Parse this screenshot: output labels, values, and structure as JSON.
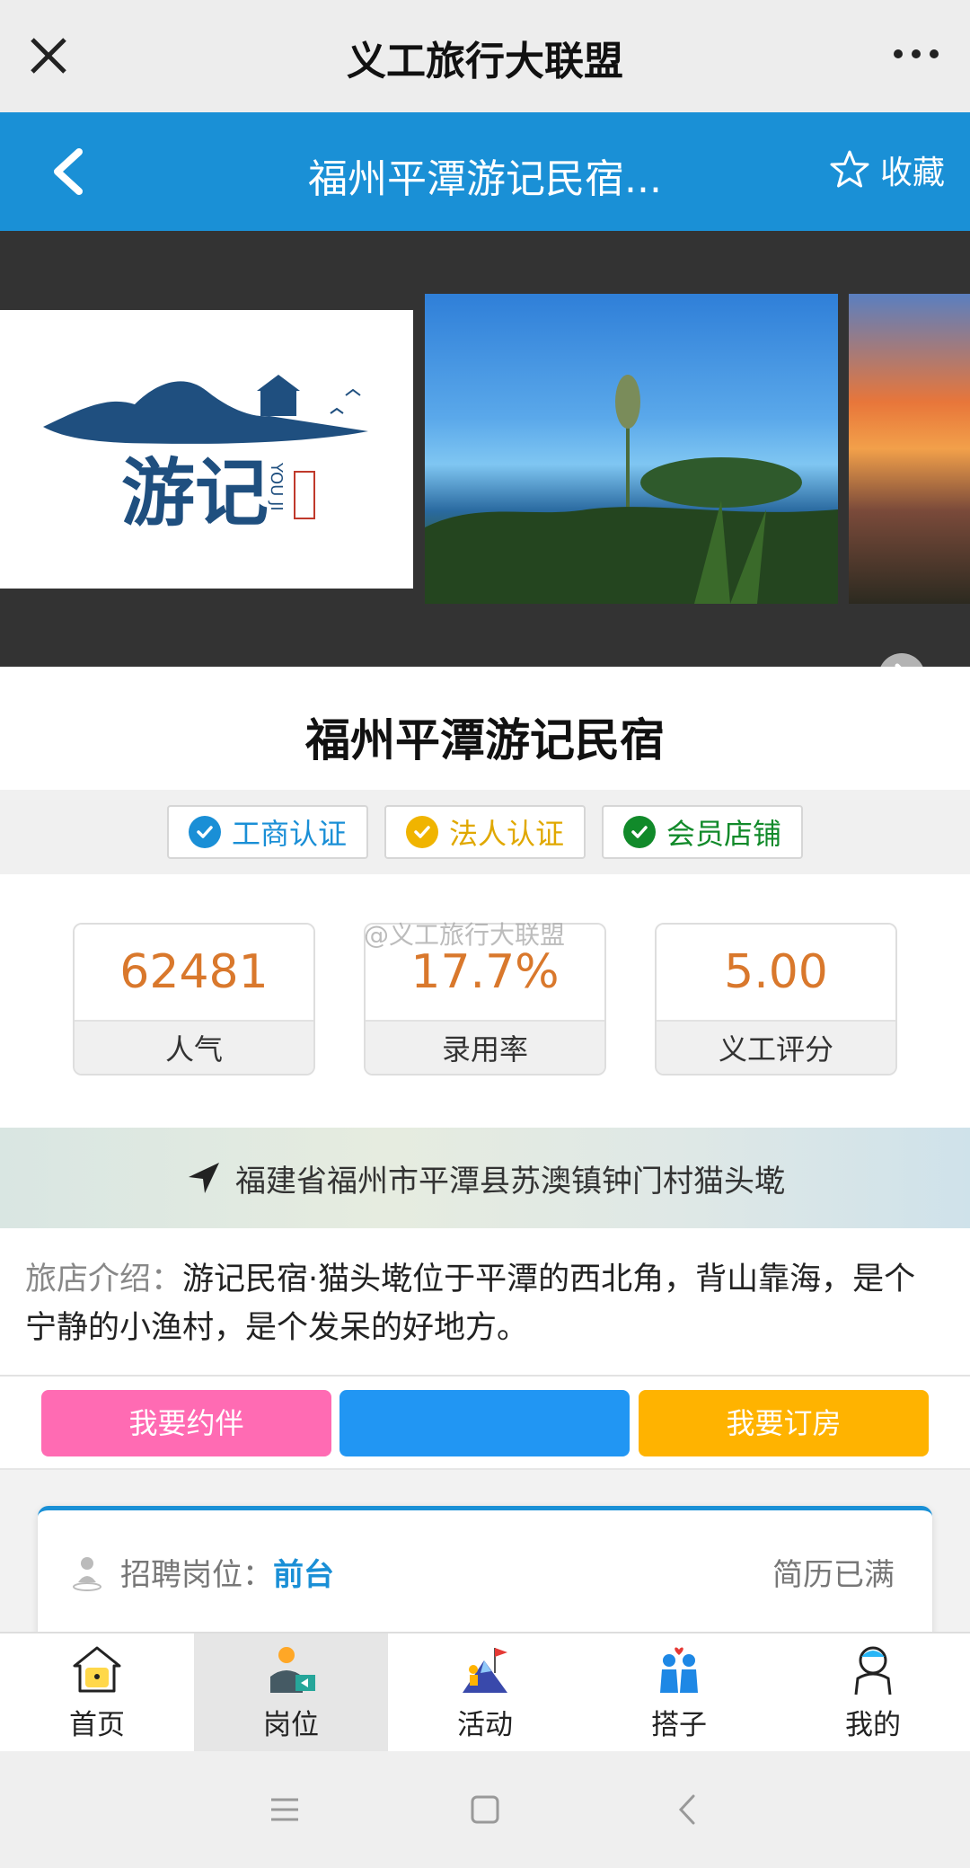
{
  "wechat_bar": {
    "title": "义工旅行大联盟"
  },
  "header": {
    "title": "福州平潭游记民宿...",
    "favorite_label": "收藏"
  },
  "carousel": {
    "slide_count": 3,
    "active_index": 0
  },
  "hostel": {
    "name": "福州平潭游记民宿"
  },
  "badges": [
    {
      "label": "工商认证",
      "color": "#1a8fd6"
    },
    {
      "label": "法人认证",
      "color": "#f0b400"
    },
    {
      "label": "会员店铺",
      "color": "#118a2a"
    }
  ],
  "stats": [
    {
      "value": "62481",
      "label": "人气"
    },
    {
      "value": "17.7%",
      "label": "录用率"
    },
    {
      "value": "5.00",
      "label": "义工评分"
    }
  ],
  "watermark": "@义工旅行大联盟",
  "address": "福建省福州市平潭县苏澳镇钟门村猫头墘",
  "intro": {
    "label": "旅店介绍：",
    "text": "游记民宿·猫头墘位于平潭的西北角，背山靠海，是个宁静的小渔村，是个发呆的好地方。"
  },
  "actions": {
    "partner": "我要约伴",
    "middle": "",
    "book": "我要订房"
  },
  "job": {
    "label": "招聘岗位：",
    "position": "前台",
    "status": "简历已满"
  },
  "tabs": [
    {
      "label": "首页",
      "icon": "home-icon"
    },
    {
      "label": "岗位",
      "icon": "job-icon"
    },
    {
      "label": "活动",
      "icon": "activity-icon"
    },
    {
      "label": "搭子",
      "icon": "partner-icon"
    },
    {
      "label": "我的",
      "icon": "profile-icon"
    }
  ],
  "colors": {
    "primary": "#1a90d6",
    "stat_value": "#d9782c",
    "pink": "#ff6bb3",
    "blue": "#2196f3",
    "amber": "#ffb300"
  }
}
